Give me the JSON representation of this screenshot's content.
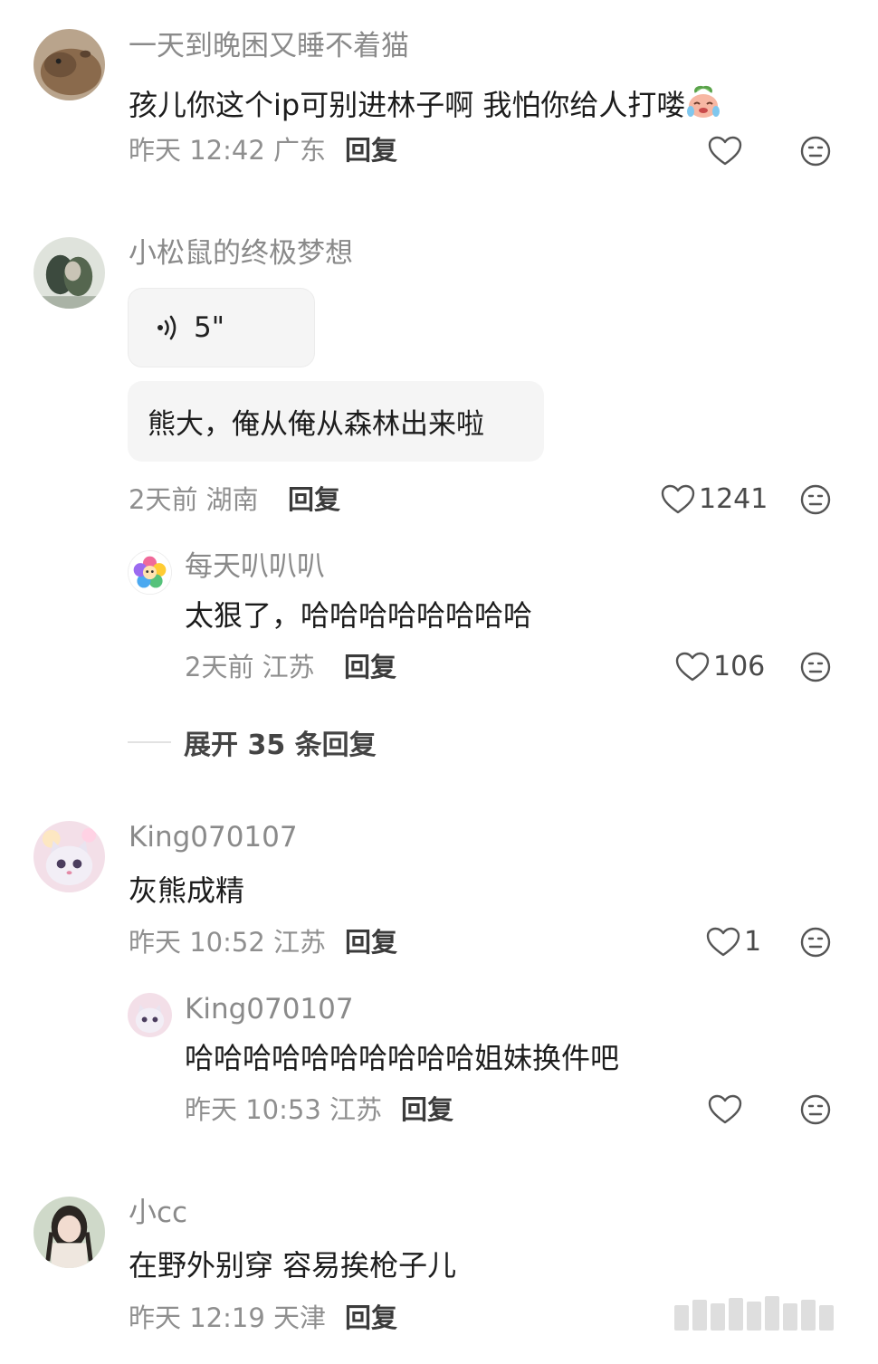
{
  "comments": [
    {
      "name": "一天到晚困又睡不着猫",
      "text": "孩儿你这个ip可别进林子啊 我怕你给人打喽",
      "time_loc": "昨天 12:42 广东",
      "reply_label": "回复",
      "likes": ""
    },
    {
      "name": "小松鼠的终极梦想",
      "voice_duration": "5\"",
      "transcript": "熊大，俺从俺从森林出来啦",
      "time_loc": "2天前 湖南",
      "reply_label": "回复",
      "likes": "1241",
      "replies": [
        {
          "name": "每天叭叭叭",
          "text": "太狠了，哈哈哈哈哈哈哈哈",
          "time_loc": "2天前 江苏",
          "reply_label": "回复",
          "likes": "106"
        }
      ],
      "expand_label": "展开 35 条回复"
    },
    {
      "name": "King070107",
      "text": "灰熊成精",
      "time_loc": "昨天 10:52 江苏",
      "reply_label": "回复",
      "likes": "1",
      "replies": [
        {
          "name": "King070107",
          "text": "哈哈哈哈哈哈哈哈哈哈姐妹换件吧",
          "time_loc": "昨天 10:53 江苏",
          "reply_label": "回复",
          "likes": ""
        }
      ]
    },
    {
      "name": "小cc",
      "text": "在野外别穿 容易挨枪子儿",
      "time_loc": "昨天 12:19 天津",
      "reply_label": "回复"
    }
  ],
  "colors": {
    "meta_text": "#8f8f8f",
    "name_text": "#8a8a8a",
    "bubble_bg": "#f5f5f5",
    "icon_stroke": "#555555"
  },
  "icons": {
    "like": "heart-outline-icon",
    "dislike": "neutral-face-icon",
    "voice": "sound-wave-icon",
    "emoji": "crying-laughing-peach-emoji"
  }
}
